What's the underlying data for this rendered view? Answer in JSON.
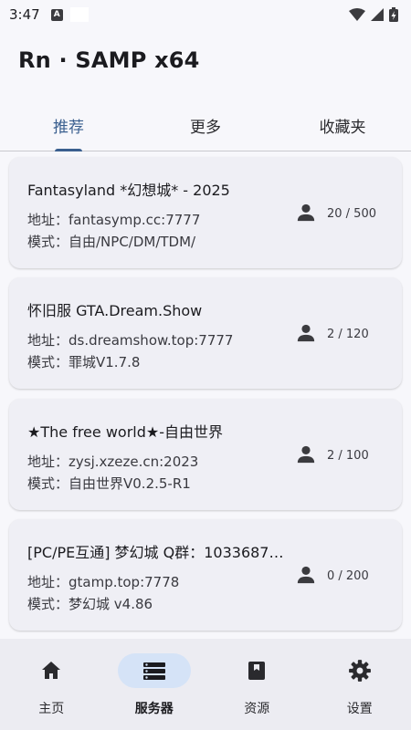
{
  "status_bar": {
    "time": "3:47",
    "notification_letter": "A"
  },
  "app": {
    "title": "Rn · SAMP x64"
  },
  "tabs": [
    {
      "label": "推荐",
      "active": true
    },
    {
      "label": "更多",
      "active": false
    },
    {
      "label": "收藏夹",
      "active": false
    }
  ],
  "servers": [
    {
      "name": "Fantasyland *幻想城* - 2025",
      "address": "地址：fantasymp.cc:7777",
      "mode": "模式：自由/NPC/DM/TDM/",
      "players": "20 / 500"
    },
    {
      "name": "怀旧服 GTA.Dream.Show",
      "address": "地址：ds.dreamshow.top:7777",
      "mode": "模式：罪城V1.7.8",
      "players": "2 / 120"
    },
    {
      "name": "★The free world★-自由世界",
      "address": "地址：zysj.xzeze.cn:2023",
      "mode": "模式：自由世界V0.2.5-R1",
      "players": "2 / 100"
    },
    {
      "name": "[PC/PE互通] 梦幻城 Q群：1033687…",
      "address": "地址：gtamp.top:7778",
      "mode": "模式：梦幻城 v4.86",
      "players": "0 / 200"
    }
  ],
  "bottom_nav": [
    {
      "label": "主页",
      "icon": "home-icon",
      "active": false
    },
    {
      "label": "服务器",
      "icon": "server-list-icon",
      "active": true
    },
    {
      "label": "资源",
      "icon": "bookmark-box-icon",
      "active": false
    },
    {
      "label": "设置",
      "icon": "gear-icon",
      "active": false
    }
  ],
  "colors": {
    "accent": "#3a5f8f",
    "active_pill": "#d5e3f7",
    "card_bg": "#efeff5",
    "background": "#f7f7fb"
  }
}
